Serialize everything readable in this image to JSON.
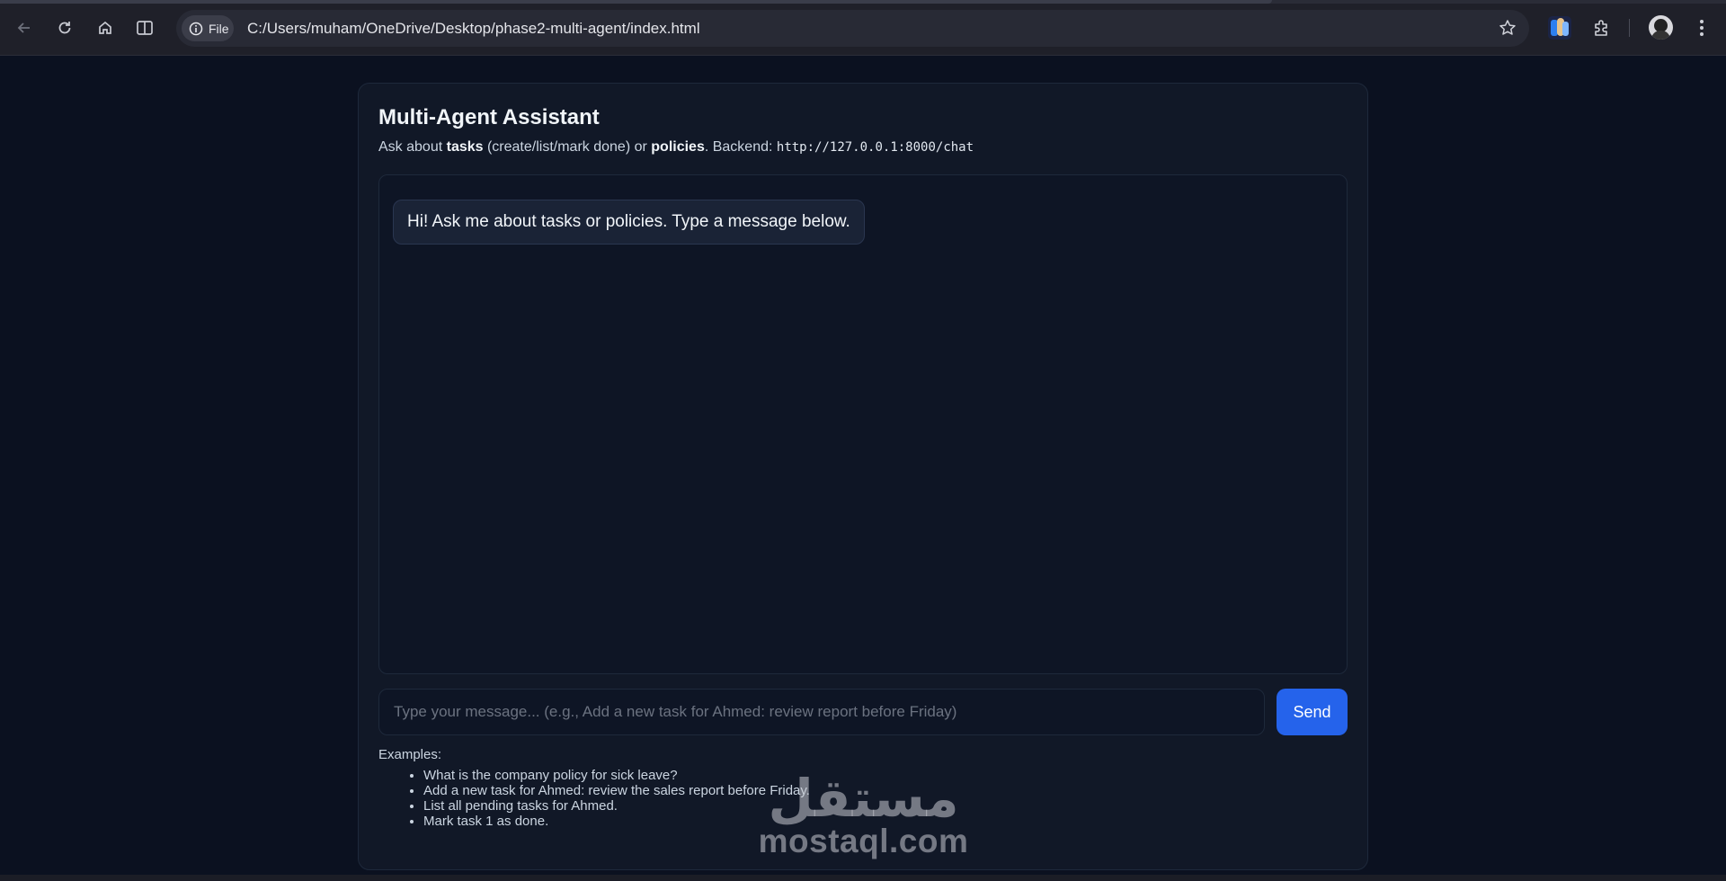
{
  "browser": {
    "file_chip_label": "File",
    "url": "C:/Users/muham/OneDrive/Desktop/phase2-multi-agent/index.html",
    "icons": [
      "back-icon",
      "reload-icon",
      "home-icon",
      "split-view-icon",
      "info-icon",
      "star-icon",
      "extension-icon",
      "puzzle-icon",
      "profile-avatar",
      "more-menu-icon"
    ]
  },
  "page": {
    "title": "Multi-Agent Assistant",
    "subtitle": {
      "p1": "Ask about ",
      "b1": "tasks",
      "p2": " (create/list/mark done) or ",
      "b2": "policies",
      "p3": ". Backend: ",
      "code": "http://127.0.0.1:8000/chat"
    },
    "messages": [
      {
        "role": "assistant",
        "text": "Hi! Ask me about tasks or policies. Type a message below."
      }
    ],
    "input": {
      "value": "",
      "placeholder": "Type your message... (e.g., Add a new task for Ahmed: review report before Friday)"
    },
    "send_label": "Send",
    "examples_label": "Examples:",
    "examples": [
      "What is the company policy for sick leave?",
      "Add a new task for Ahmed: review the sales report before Friday.",
      "List all pending tasks for Ahmed.",
      "Mark task 1 as done."
    ]
  },
  "watermark": {
    "arabic": "مستقل",
    "latin": "mostaql.com"
  },
  "colors": {
    "background": "#0b1120",
    "card": "#111827",
    "accent": "#2563eb",
    "text": "#f1f5f9"
  }
}
